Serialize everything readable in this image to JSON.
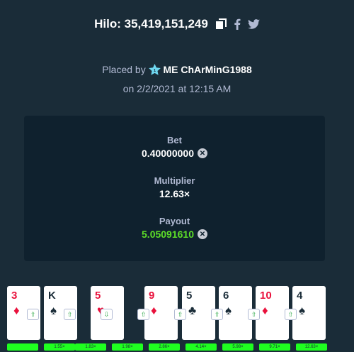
{
  "header": {
    "title": "Hilo: 35,419,151,249",
    "copy_icon": "copy-icon",
    "facebook_icon": "facebook-icon",
    "twitter_icon": "twitter-icon"
  },
  "placed": {
    "prefix": "Placed by",
    "user": "ME ChArMinG1988",
    "date": "on 2/2/2021 at 12:15 AM"
  },
  "stats": {
    "bet_label": "Bet",
    "bet_value": "0.40000000",
    "multiplier_label": "Multiplier",
    "multiplier_value": "12.63×",
    "payout_label": "Payout",
    "payout_value": "5.05091610"
  },
  "colors": {
    "background": "#1a2c38",
    "panel": "#0f212e",
    "payout_green": "#5dde28",
    "card_red": "#e9113c",
    "multiplier_green": "#1fff20"
  },
  "cards": [
    {
      "rank": "3",
      "suit": "♦",
      "color": "red",
      "badge": "⇧",
      "pill": "1.55×"
    },
    {
      "rank": "K",
      "suit": "♠",
      "color": "black",
      "badge": "⇧",
      "pill": "1.83×"
    },
    {
      "rank": "5",
      "suit": "♥",
      "color": "red",
      "badge": "⇩",
      "pill": "1.98×"
    },
    {
      "rank": "9",
      "suit": "♦",
      "color": "red",
      "badge": "⇧",
      "pill": "2.86×"
    },
    {
      "rank": "5",
      "suit": "♣",
      "color": "black",
      "badge": "⇧",
      "pill": "4.14×"
    },
    {
      "rank": "6",
      "suit": "♠",
      "color": "black",
      "badge": "⇧",
      "pill": "5.98×"
    },
    {
      "rank": "10",
      "suit": "♦",
      "color": "red",
      "badge": "⇧",
      "pill": "9.71×"
    },
    {
      "rank": "4",
      "suit": "♠",
      "color": "black",
      "badge": "⇧",
      "pill": "12.63×"
    }
  ]
}
